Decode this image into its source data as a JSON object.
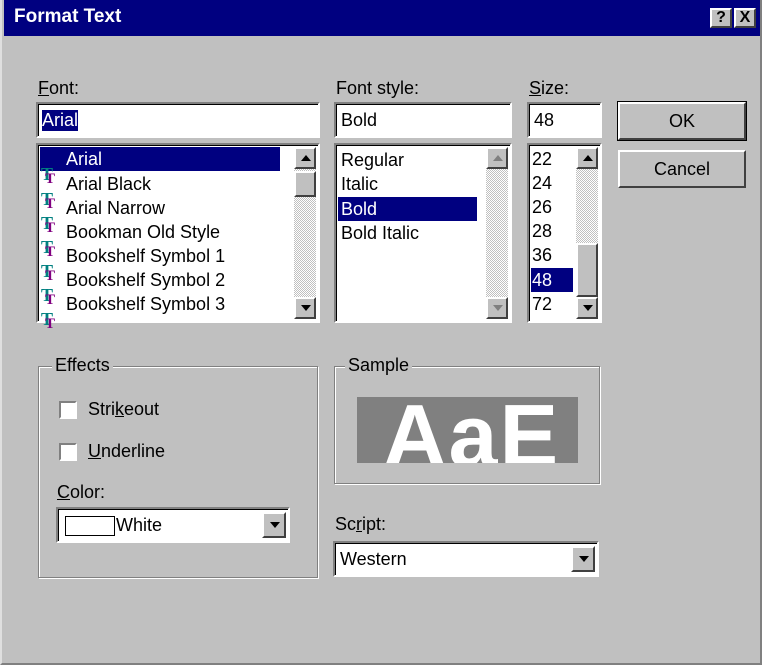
{
  "window": {
    "title": "Format Text"
  },
  "titlebar_buttons": {
    "help": "?",
    "close": "X"
  },
  "font": {
    "label": "Font:",
    "label_accel": "F",
    "label_rest": "ont:",
    "value": "Arial",
    "items": [
      "Arial",
      "Arial Black",
      "Arial Narrow",
      "Bookman Old Style",
      "Bookshelf Symbol 1",
      "Bookshelf Symbol 2",
      "Bookshelf Symbol 3"
    ],
    "selected": "Arial",
    "item_icon": "truetype-font-icon"
  },
  "font_style": {
    "label": "Font style:",
    "value": "Bold",
    "items": [
      "Regular",
      "Italic",
      "Bold",
      "Bold Italic"
    ],
    "selected": "Bold"
  },
  "size": {
    "label": "Size:",
    "label_accel": "S",
    "label_rest": "ize:",
    "value": "48",
    "items": [
      "22",
      "24",
      "26",
      "28",
      "36",
      "48",
      "72"
    ],
    "selected": "48"
  },
  "buttons": {
    "ok": "OK",
    "cancel": "Cancel"
  },
  "effects": {
    "label": "Effects",
    "strikeout": {
      "pre": "Stri",
      "accel": "k",
      "post": "eout",
      "checked": false
    },
    "underline": {
      "pre": "",
      "accel": "U",
      "post": "nderline",
      "checked": false
    },
    "color_label": {
      "accel": "C",
      "rest": "olor:"
    },
    "color_value": "White",
    "color_swatch": "#ffffff"
  },
  "sample": {
    "label": "Sample",
    "text": "AaE"
  },
  "script": {
    "label_pre": "Sc",
    "label_accel": "r",
    "label_post": "ipt:",
    "value": "Western"
  },
  "colors": {
    "titlebar": "#000080",
    "face": "#c0c0c0",
    "selection": "#000080",
    "sample_bg": "#808080"
  }
}
